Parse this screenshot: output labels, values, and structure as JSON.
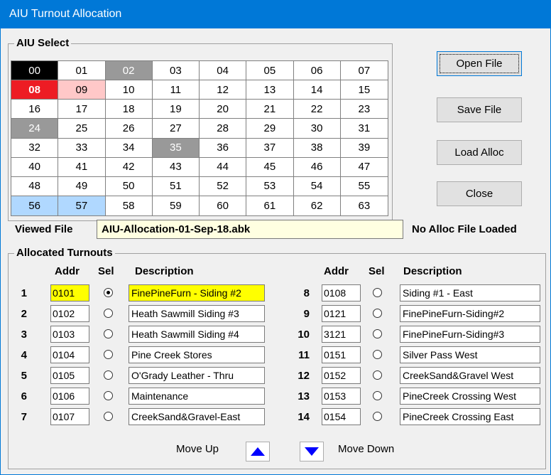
{
  "window": {
    "title": "AIU Turnout Allocation"
  },
  "aiu_select": {
    "legend": "AIU Select",
    "cells": [
      {
        "label": "00",
        "state": "black"
      },
      {
        "label": "01",
        "state": "none"
      },
      {
        "label": "02",
        "state": "gray"
      },
      {
        "label": "03",
        "state": "none"
      },
      {
        "label": "04",
        "state": "none"
      },
      {
        "label": "05",
        "state": "none"
      },
      {
        "label": "06",
        "state": "none"
      },
      {
        "label": "07",
        "state": "none"
      },
      {
        "label": "08",
        "state": "red"
      },
      {
        "label": "09",
        "state": "pink"
      },
      {
        "label": "10",
        "state": "none"
      },
      {
        "label": "11",
        "state": "none"
      },
      {
        "label": "12",
        "state": "none"
      },
      {
        "label": "13",
        "state": "none"
      },
      {
        "label": "14",
        "state": "none"
      },
      {
        "label": "15",
        "state": "none"
      },
      {
        "label": "16",
        "state": "none"
      },
      {
        "label": "17",
        "state": "none"
      },
      {
        "label": "18",
        "state": "none"
      },
      {
        "label": "19",
        "state": "none"
      },
      {
        "label": "20",
        "state": "none"
      },
      {
        "label": "21",
        "state": "none"
      },
      {
        "label": "22",
        "state": "none"
      },
      {
        "label": "23",
        "state": "none"
      },
      {
        "label": "24",
        "state": "gray"
      },
      {
        "label": "25",
        "state": "none"
      },
      {
        "label": "26",
        "state": "none"
      },
      {
        "label": "27",
        "state": "none"
      },
      {
        "label": "28",
        "state": "none"
      },
      {
        "label": "29",
        "state": "none"
      },
      {
        "label": "30",
        "state": "none"
      },
      {
        "label": "31",
        "state": "none"
      },
      {
        "label": "32",
        "state": "none"
      },
      {
        "label": "33",
        "state": "none"
      },
      {
        "label": "34",
        "state": "none"
      },
      {
        "label": "35",
        "state": "gray"
      },
      {
        "label": "36",
        "state": "none"
      },
      {
        "label": "37",
        "state": "none"
      },
      {
        "label": "38",
        "state": "none"
      },
      {
        "label": "39",
        "state": "none"
      },
      {
        "label": "40",
        "state": "none"
      },
      {
        "label": "41",
        "state": "none"
      },
      {
        "label": "42",
        "state": "none"
      },
      {
        "label": "43",
        "state": "none"
      },
      {
        "label": "44",
        "state": "none"
      },
      {
        "label": "45",
        "state": "none"
      },
      {
        "label": "46",
        "state": "none"
      },
      {
        "label": "47",
        "state": "none"
      },
      {
        "label": "48",
        "state": "none"
      },
      {
        "label": "49",
        "state": "none"
      },
      {
        "label": "50",
        "state": "none"
      },
      {
        "label": "51",
        "state": "none"
      },
      {
        "label": "52",
        "state": "none"
      },
      {
        "label": "53",
        "state": "none"
      },
      {
        "label": "54",
        "state": "none"
      },
      {
        "label": "55",
        "state": "none"
      },
      {
        "label": "56",
        "state": "blue"
      },
      {
        "label": "57",
        "state": "blue"
      },
      {
        "label": "58",
        "state": "none"
      },
      {
        "label": "59",
        "state": "none"
      },
      {
        "label": "60",
        "state": "none"
      },
      {
        "label": "61",
        "state": "none"
      },
      {
        "label": "62",
        "state": "none"
      },
      {
        "label": "63",
        "state": "none"
      }
    ]
  },
  "buttons": {
    "open_file": "Open File",
    "save_file": "Save File",
    "load_alloc": "Load Alloc",
    "close": "Close"
  },
  "viewed_file": {
    "label": "Viewed File",
    "value": "AIU-Allocation-01-Sep-18.abk"
  },
  "status": "No Alloc File Loaded",
  "turnouts": {
    "legend": "Allocated Turnouts",
    "headers": {
      "addr": "Addr",
      "sel": "Sel",
      "description": "Description"
    },
    "rows": [
      {
        "num": "1",
        "addr": "0101",
        "selected": true,
        "description": "FinePineFurn - Siding #2",
        "highlight": true
      },
      {
        "num": "2",
        "addr": "0102",
        "selected": false,
        "description": "Heath Sawmill Siding #3",
        "highlight": false
      },
      {
        "num": "3",
        "addr": "0103",
        "selected": false,
        "description": "Heath Sawmill Siding #4",
        "highlight": false
      },
      {
        "num": "4",
        "addr": "0104",
        "selected": false,
        "description": "Pine Creek Stores",
        "highlight": false
      },
      {
        "num": "5",
        "addr": "0105",
        "selected": false,
        "description": "O'Grady Leather - Thru",
        "highlight": false
      },
      {
        "num": "6",
        "addr": "0106",
        "selected": false,
        "description": "Maintenance",
        "highlight": false
      },
      {
        "num": "7",
        "addr": "0107",
        "selected": false,
        "description": "CreekSand&Gravel-East",
        "highlight": false
      },
      {
        "num": "8",
        "addr": "0108",
        "selected": false,
        "description": "Siding #1 - East",
        "highlight": false
      },
      {
        "num": "9",
        "addr": "0121",
        "selected": false,
        "description": "FinePineFurn-Siding#2",
        "highlight": false
      },
      {
        "num": "10",
        "addr": "3121",
        "selected": false,
        "description": "FinePineFurn-Siding#3",
        "highlight": false
      },
      {
        "num": "11",
        "addr": "0151",
        "selected": false,
        "description": "Silver Pass West",
        "highlight": false
      },
      {
        "num": "12",
        "addr": "0152",
        "selected": false,
        "description": "CreekSand&Gravel West",
        "highlight": false
      },
      {
        "num": "13",
        "addr": "0153",
        "selected": false,
        "description": "PineCreek Crossing West",
        "highlight": false
      },
      {
        "num": "14",
        "addr": "0154",
        "selected": false,
        "description": "PineCreek Crossing East",
        "highlight": false
      }
    ],
    "move_up": "Move Up",
    "move_down": "Move Down",
    "move_up_icon": "arrow-up-icon",
    "move_down_icon": "arrow-down-icon"
  },
  "colors": {
    "titlebar": "#0078d7",
    "highlight": "#ffff00",
    "viewed_file_bg": "#ffffe1",
    "arrow": "#0000ff"
  }
}
